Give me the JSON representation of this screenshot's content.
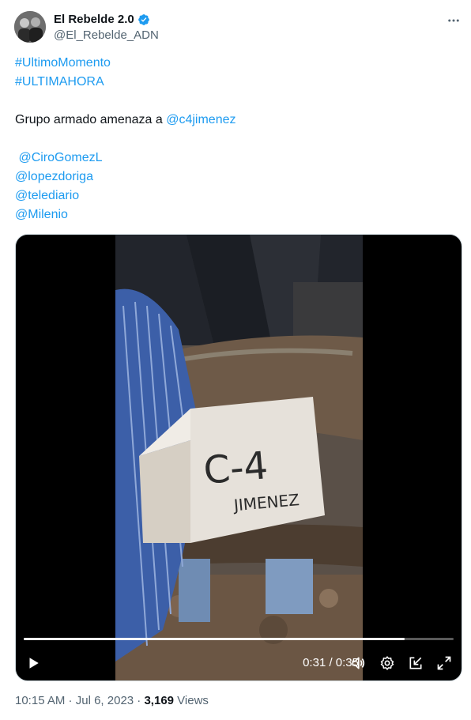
{
  "author": {
    "display_name": "El Rebelde 2.0",
    "handle": "@El_Rebelde_ADN",
    "verified": true,
    "avatar_icon": "avatar-photo"
  },
  "tweet": {
    "lines": [
      {
        "text": "#UltimoMomento",
        "kind": "link"
      },
      {
        "text": "#ULTIMAHORA",
        "kind": "link"
      },
      {
        "text": "",
        "kind": "blank"
      },
      {
        "text": "Grupo armado amenaza a ",
        "kind": "text",
        "mention": "@c4jimenez"
      },
      {
        "text": "",
        "kind": "blank"
      },
      {
        "text": " @CiroGomezL",
        "kind": "link"
      },
      {
        "text": "@lopezdoriga",
        "kind": "link"
      },
      {
        "text": "@telediario",
        "kind": "link"
      },
      {
        "text": "@Milenio",
        "kind": "link"
      }
    ],
    "sign_text_on_box": "C-4 JIMENEZ"
  },
  "video": {
    "time_display": "0:31 / 0:35",
    "progress": 0.886,
    "controls": [
      "play-icon",
      "volume-icon",
      "settings-icon",
      "pip-icon",
      "fullscreen-icon"
    ]
  },
  "meta": {
    "time": "10:15 AM",
    "separator": " · ",
    "date": "Jul 6, 2023",
    "views_count": "3,169",
    "views_label": " Views"
  },
  "colors": {
    "link": "#1d9bf0",
    "text": "#0f1419",
    "secondary": "#536471",
    "verified": "#1d9bf0"
  }
}
